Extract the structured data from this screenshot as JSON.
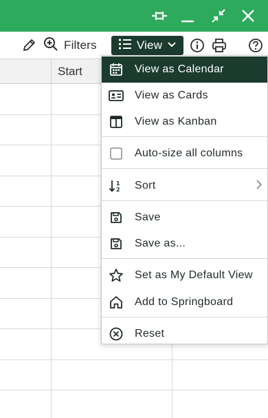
{
  "colors": {
    "titlebar": "#2eaa5c",
    "accent_dark": "#1b3b2e"
  },
  "titlebar": {
    "icons": [
      "pin-icon",
      "minimize-icon",
      "collapse-icon",
      "close-icon"
    ]
  },
  "toolbar": {
    "filters_label": "Filters",
    "view_label": "View"
  },
  "grid": {
    "columns": [
      {
        "label": ""
      },
      {
        "label": "Start"
      },
      {
        "label": ""
      }
    ]
  },
  "view_menu": {
    "items": [
      {
        "id": "calendar",
        "label": "View as Calendar",
        "icon": "calendar-icon",
        "active": true
      },
      {
        "id": "cards",
        "label": "View as Cards",
        "icon": "id-card-icon"
      },
      {
        "id": "kanban",
        "label": "View as Kanban",
        "icon": "kanban-icon"
      },
      {
        "id": "autosize",
        "label": "Auto-size all columns",
        "icon": "checkbox-icon"
      },
      {
        "id": "sort",
        "label": "Sort",
        "icon": "sort-icon",
        "submenu": true
      },
      {
        "id": "save",
        "label": "Save",
        "icon": "save-icon"
      },
      {
        "id": "saveas",
        "label": "Save as...",
        "icon": "save-as-icon"
      },
      {
        "id": "default",
        "label": "Set as My Default View",
        "icon": "star-icon"
      },
      {
        "id": "springboard",
        "label": "Add to Springboard",
        "icon": "home-icon"
      },
      {
        "id": "reset",
        "label": "Reset",
        "icon": "reset-icon"
      }
    ]
  }
}
